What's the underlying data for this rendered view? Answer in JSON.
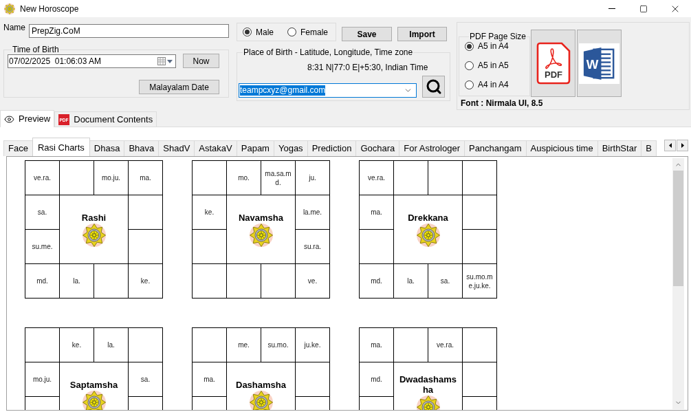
{
  "window": {
    "title": "New Horoscope"
  },
  "name": {
    "label": "Name",
    "value": "PrepZig.CoM"
  },
  "time_of_birth": {
    "title": "Time of Birth",
    "value": "07/02/2025  01:06:03 AM",
    "now_button": "Now",
    "date_button": "Malayalam Date"
  },
  "gender": [
    {
      "label": "Male",
      "selected": true
    },
    {
      "label": "Female",
      "selected": false
    }
  ],
  "actions": [
    "Save",
    "Import"
  ],
  "place_of_birth": {
    "title": "Place of Birth - Latitude, Longitude, Time zone",
    "coordinates": "8:31 N|77:0 E|+5:30, Indian Time",
    "value": "teampcxyz@gmail.com",
    "value_highlighted": true
  },
  "pdf_page_size": {
    "title": "PDF Page Size",
    "options": [
      {
        "label": "A5 in A4",
        "selected": true
      },
      {
        "label": "A5 in A5",
        "selected": false
      },
      {
        "label": "A4 in A4",
        "selected": false
      }
    ]
  },
  "export_buttons": [
    {
      "kind": "pdf",
      "icon_text": "PDF"
    },
    {
      "kind": "word",
      "icon_text": "W"
    }
  ],
  "font_info": "Font : Nirmala UI, 8.5",
  "view_tabs": [
    {
      "kind": "preview",
      "label": "Preview",
      "selected": true
    },
    {
      "kind": "pdf",
      "label": "Document Contents",
      "icon_text": "PDF",
      "selected": false
    }
  ],
  "tabs": [
    {
      "label": "Face",
      "selected": false
    },
    {
      "label": "Rasi Charts",
      "selected": true
    },
    {
      "label": "Dhasa",
      "selected": false
    },
    {
      "label": "Bhava",
      "selected": false
    },
    {
      "label": "ShadV",
      "selected": false
    },
    {
      "label": "AstakaV",
      "selected": false
    },
    {
      "label": "Papam",
      "selected": false
    },
    {
      "label": "Yogas",
      "selected": false
    },
    {
      "label": "Prediction",
      "selected": false
    },
    {
      "label": "Gochara",
      "selected": false
    },
    {
      "label": "For Astrologer",
      "selected": false
    },
    {
      "label": "Panchangam",
      "selected": false
    },
    {
      "label": "Auspicious time",
      "selected": false
    },
    {
      "label": "BirthStar",
      "selected": false
    },
    {
      "label": "B",
      "selected": false
    }
  ],
  "charts": [
    {
      "title": "Rashi",
      "rows": [
        [
          "ve.ra.",
          null,
          "mo.ju.",
          "ma."
        ],
        [
          "sa.",
          null
        ],
        [
          "su.me.",
          null
        ],
        [
          "md.",
          "la.",
          null,
          "ke."
        ]
      ]
    },
    {
      "title": "Navamsha",
      "rows": [
        [
          null,
          "mo.",
          "ma.sa.md.",
          "ju."
        ],
        [
          "ke.",
          "la.me."
        ],
        [
          null,
          "su.ra."
        ],
        [
          null,
          null,
          null,
          "ve."
        ]
      ]
    },
    {
      "title": "Drekkana",
      "rows": [
        [
          "ve.ra.",
          null,
          null,
          null
        ],
        [
          "ma.",
          null
        ],
        [
          null,
          null
        ],
        [
          "md.",
          "la.",
          "sa.",
          "su.mo.me.ju.ke."
        ]
      ]
    },
    {
      "title": "Saptamsha",
      "rows": [
        [
          null,
          "ke.",
          "la.",
          null
        ],
        [
          "mo.ju.",
          "sa."
        ]
      ]
    },
    {
      "title": "Dashamsha",
      "rows": [
        [
          null,
          "me.",
          "su.mo.",
          "ju.ke."
        ],
        [
          "ma.",
          null
        ]
      ]
    },
    {
      "title": "Dwadashamsha",
      "rows": [
        [
          "ma.",
          null,
          "ve.ra.",
          null
        ],
        [
          "md.",
          null
        ]
      ]
    }
  ]
}
